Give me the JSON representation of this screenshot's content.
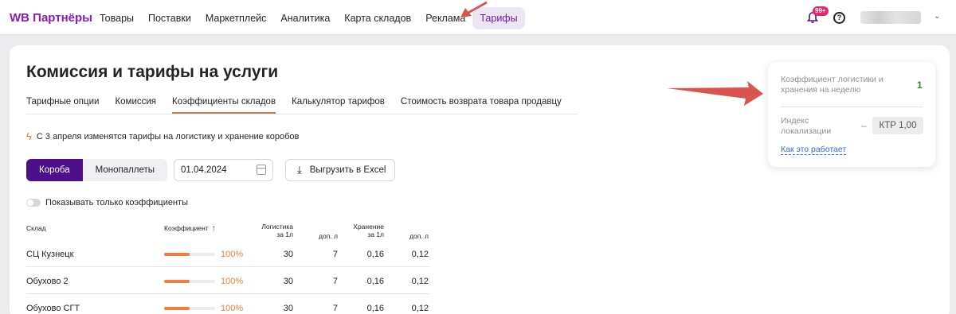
{
  "header": {
    "logo": "WB Партнёры",
    "nav": [
      {
        "label": "Товары"
      },
      {
        "label": "Поставки"
      },
      {
        "label": "Маркетплейс"
      },
      {
        "label": "Аналитика"
      },
      {
        "label": "Карта складов"
      },
      {
        "label": "Реклама"
      },
      {
        "label": "Тарифы",
        "active": true
      }
    ],
    "notifications_badge": "99+",
    "help_glyph": "?"
  },
  "page": {
    "title": "Комиссия и тарифы на услуги",
    "tabs": [
      {
        "label": "Тарифные опции"
      },
      {
        "label": "Комиссия"
      },
      {
        "label": "Коэффициенты складов",
        "active": true
      },
      {
        "label": "Калькулятор тарифов"
      },
      {
        "label": "Стоимость возврата товара продавцу"
      }
    ],
    "notice": "С 3 апреля изменятся тарифы на логистику и хранение коробов",
    "segments": {
      "active": "Короба",
      "inactive": "Монопаллеты"
    },
    "date_value": "01.04.2024",
    "export_label": "Выгрузить в Excel",
    "toggle_label": "Показывать только коэффициенты"
  },
  "table": {
    "headers": {
      "warehouse": "Склад",
      "coef": "Коэффициент",
      "logistics_1": "Логистика",
      "logistics_2": "за 1л",
      "logistics_extra": "доп. л",
      "storage_1": "Хранение",
      "storage_2": "за 1л",
      "storage_extra": "доп. л"
    },
    "rows": [
      {
        "warehouse": "СЦ Кузнецк",
        "coef": "100%",
        "coef_fraction": 0.5,
        "logistics": "30",
        "logistics_extra": "7",
        "storage": "0,16",
        "storage_extra": "0,12"
      },
      {
        "warehouse": "Обухово 2",
        "coef": "100%",
        "coef_fraction": 0.5,
        "logistics": "30",
        "logistics_extra": "7",
        "storage": "0,16",
        "storage_extra": "0,12"
      },
      {
        "warehouse": "Обухово СГТ",
        "coef": "100%",
        "coef_fraction": 0.5,
        "logistics": "30",
        "logistics_extra": "7",
        "storage": "0,16",
        "storage_extra": "0,12"
      }
    ]
  },
  "info_card": {
    "label1": "Коэффициент логистики и хранения на неделю",
    "value1": "1",
    "label2": "Индекс локализации",
    "dash": "–",
    "chip": "КТР 1,00",
    "link": "Как это работает"
  },
  "colors": {
    "brand": "#8a1bbb",
    "accent_purple": "#4d0f8a",
    "arrow": "#d9534f",
    "bar": "#f07e3c",
    "green": "#2e8a2e",
    "link": "#3a68d8"
  }
}
